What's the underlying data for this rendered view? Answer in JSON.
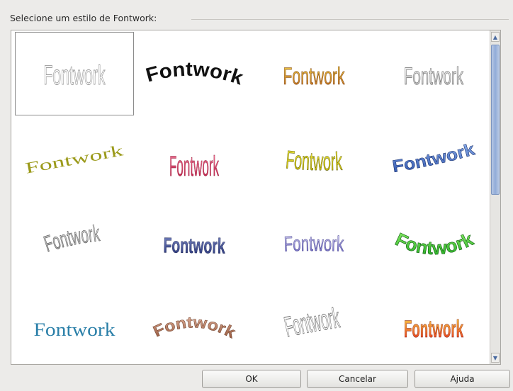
{
  "dialog": {
    "group_label": "Selecione um estilo de Fontwork:"
  },
  "gallery": {
    "sample_text": "Fontwork",
    "selected_index": 0,
    "items": [
      {
        "style": "outline-gray"
      },
      {
        "style": "black-arch"
      },
      {
        "style": "gold-gradient"
      },
      {
        "style": "silver-outline"
      },
      {
        "style": "olive-slant"
      },
      {
        "style": "pink-perspective"
      },
      {
        "style": "yellow-wave"
      },
      {
        "style": "blue-rise"
      },
      {
        "style": "gray-3d-curve"
      },
      {
        "style": "navy-3d"
      },
      {
        "style": "purple-bulge"
      },
      {
        "style": "green-arc"
      },
      {
        "style": "teal-plain"
      },
      {
        "style": "brown-arch"
      },
      {
        "style": "gray-fan"
      },
      {
        "style": "red-orange-gradient"
      }
    ]
  },
  "buttons": {
    "ok": "OK",
    "cancel": "Cancelar",
    "help": "Ajuda"
  }
}
